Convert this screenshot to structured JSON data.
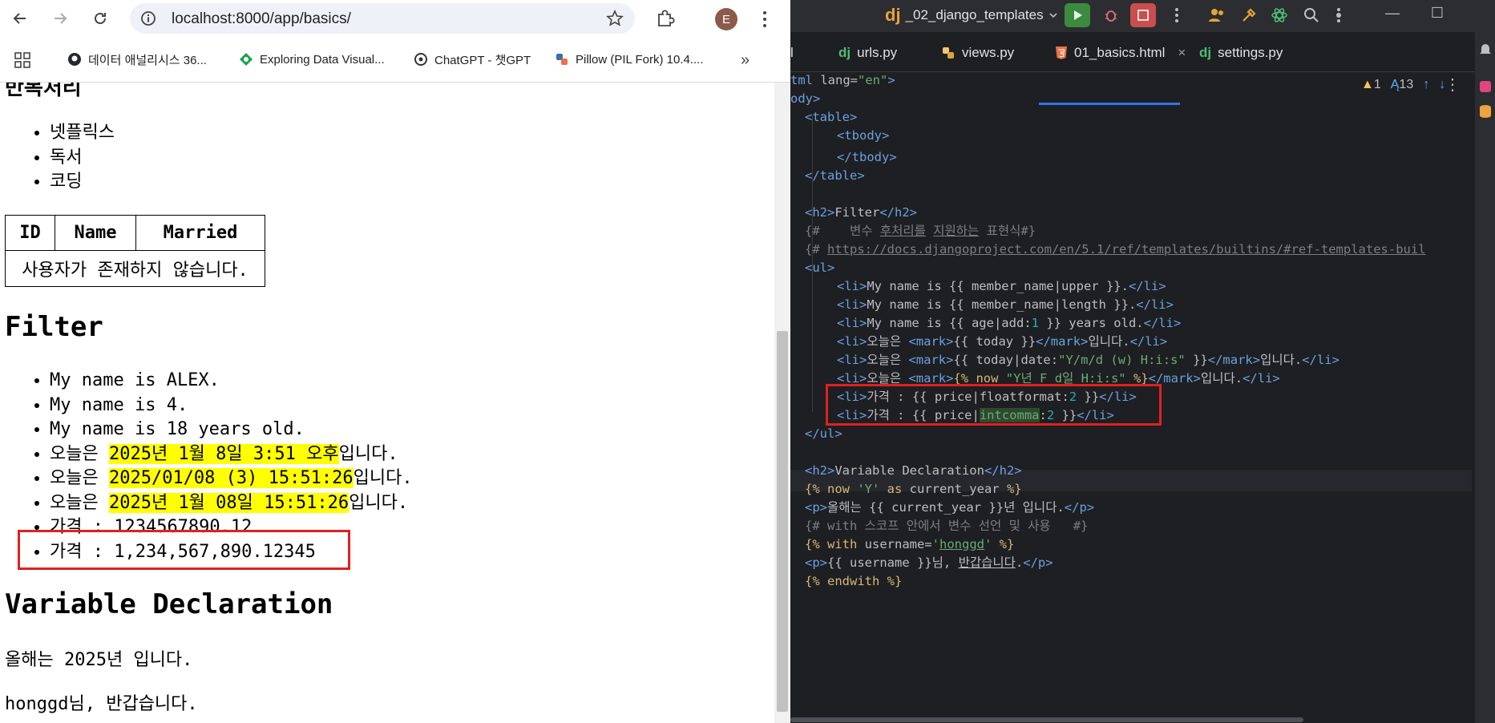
{
  "browser": {
    "url": "localhost:8000/app/basics/",
    "avatar_letter": "E",
    "bookmarks": [
      {
        "label": "데이터 애널리시스 36...",
        "icon": "github-icon"
      },
      {
        "label": "Exploring Data Visual...",
        "icon": "diamond-icon"
      },
      {
        "label": "ChatGPT - 챗GPT",
        "icon": "openai-icon"
      },
      {
        "label": "Pillow (PIL Fork) 10.4....",
        "icon": "python-icon"
      }
    ],
    "more_bookmarks": "»"
  },
  "page": {
    "loop_heading": "반복처리",
    "hobbies": [
      "넷플릭스",
      "독서",
      "코딩"
    ],
    "table": {
      "headers": [
        "ID",
        "Name",
        "Married"
      ],
      "empty_message": "사용자가 존재하지 않습니다."
    },
    "filter_heading": "Filter",
    "filter_items": [
      {
        "pre": "My name is ALEX.",
        "mark": "",
        "post": ""
      },
      {
        "pre": "My name is 4.",
        "mark": "",
        "post": ""
      },
      {
        "pre": "My name is 18 years old.",
        "mark": "",
        "post": ""
      },
      {
        "pre": "오늘은 ",
        "mark": "2025년 1월 8일 3:51 오후",
        "post": "입니다."
      },
      {
        "pre": "오늘은 ",
        "mark": "2025/01/08 (3) 15:51:26",
        "post": "입니다."
      },
      {
        "pre": "오늘은 ",
        "mark": "2025년 1월 08일 15:51:26",
        "post": "입니다."
      },
      {
        "pre": "가격 : 1234567890.12",
        "mark": "",
        "post": ""
      },
      {
        "pre": "가격 : 1,234,567,890.12345",
        "mark": "",
        "post": ""
      }
    ],
    "vardecl_heading": "Variable Declaration",
    "year_text": "올해는 2025년 입니다.",
    "greeting_text": "honggd님, 반갑습니다."
  },
  "ide": {
    "project": "_02_django_templates",
    "tabs": [
      {
        "label": "l",
        "icon": "none",
        "active": false
      },
      {
        "label": "urls.py",
        "icon": "django-icon",
        "active": false
      },
      {
        "label": "views.py",
        "icon": "python-icon",
        "active": false
      },
      {
        "label": "01_basics.html",
        "icon": "html-icon",
        "active": true
      },
      {
        "label": "settings.py",
        "icon": "django-icon",
        "active": false
      }
    ],
    "inspections": {
      "warnings": "1",
      "typos": "13"
    },
    "colors": {
      "tag": "#6ba0e0",
      "string": "#6aab73",
      "comment": "#7a7e85",
      "template": "#d5b778",
      "highlight_box": "#e02020"
    }
  }
}
